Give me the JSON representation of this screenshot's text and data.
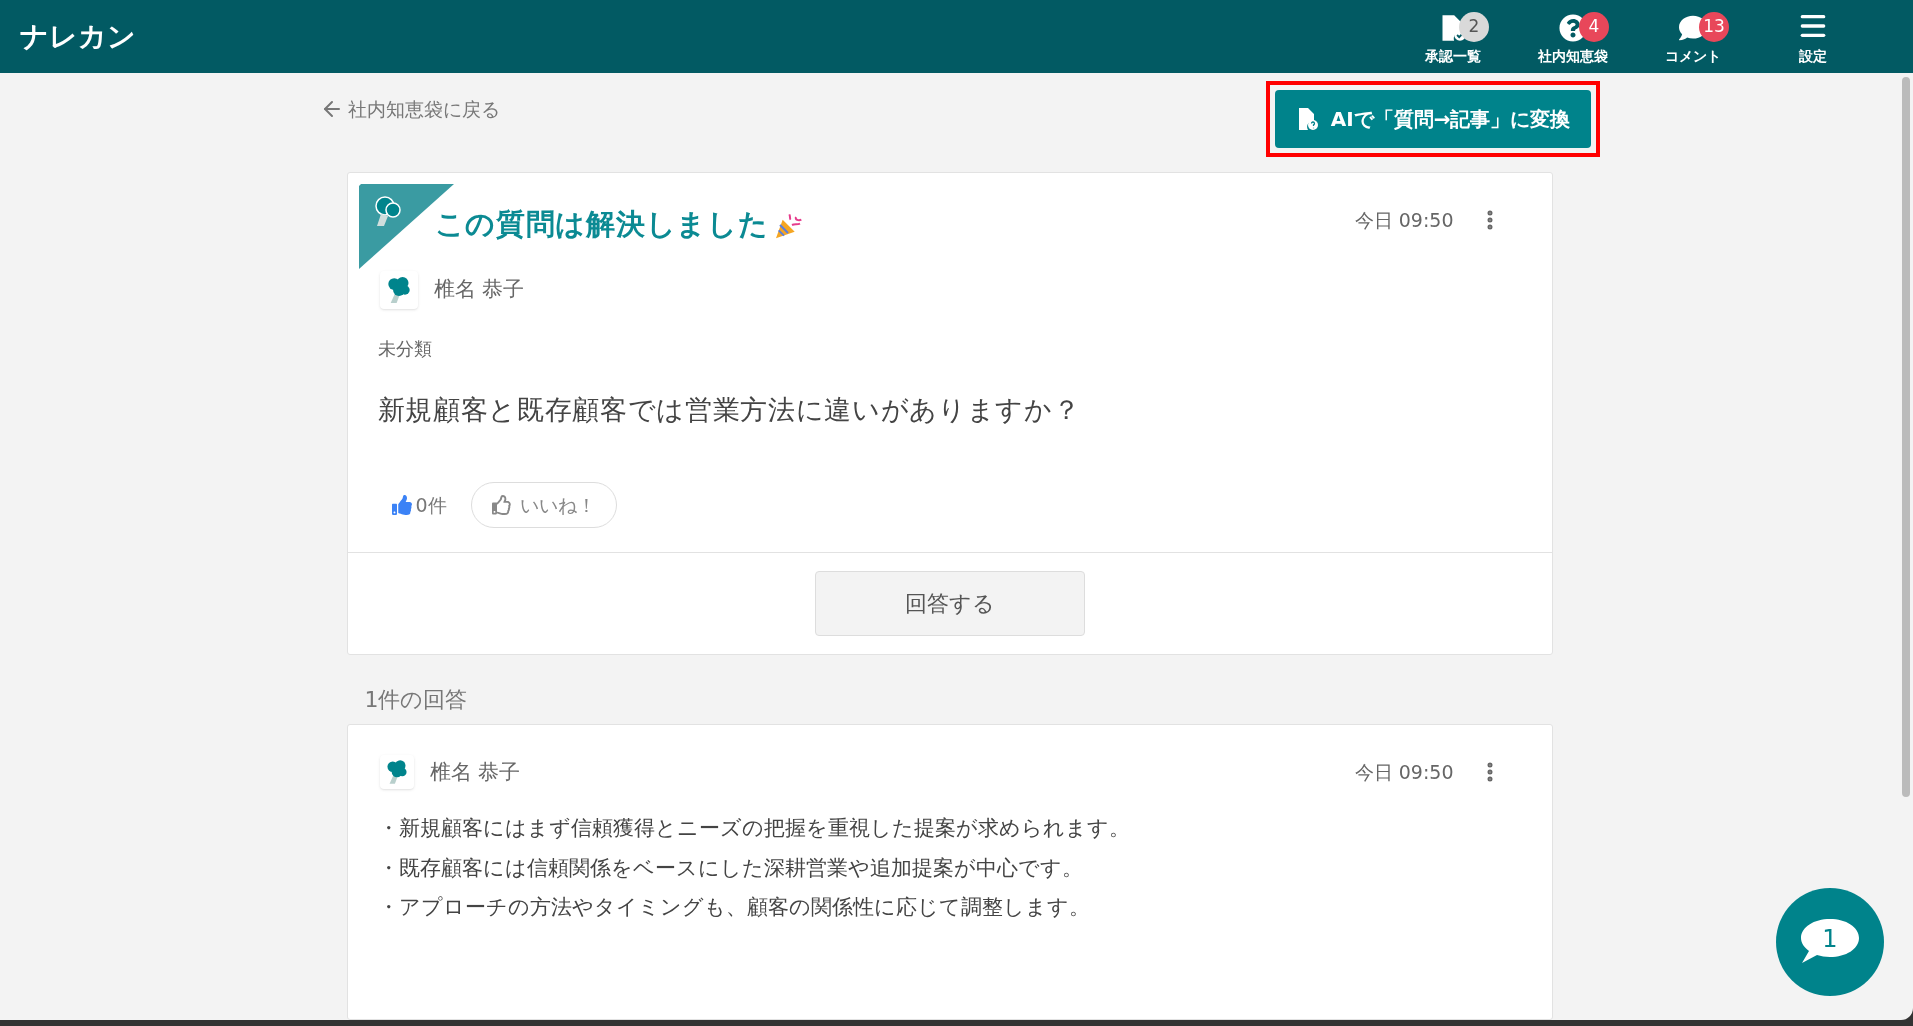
{
  "app": {
    "title": "ナレカン"
  },
  "nav": [
    {
      "kind": "approval",
      "label": "承認一覧",
      "badge": "2",
      "color": "#d9d9d9"
    },
    {
      "kind": "question",
      "label": "社内知恵袋",
      "badge": "4",
      "color": "#e8475a"
    },
    {
      "kind": "comment",
      "label": "コメント",
      "badge": "13",
      "color": "#e8475a"
    },
    {
      "kind": "menu",
      "label": "設定"
    }
  ],
  "back_link": "社内知恵袋に戻る",
  "convert_button": "AIで「質問→記事」に変換",
  "question": {
    "resolved_banner": "この質問は解決しました",
    "time": "今日 09:50",
    "author": "椎名 恭子",
    "category": "未分類",
    "body": "新規顧客と既存顧客では営業方法に違いがありますか？",
    "like_count": "0件",
    "like_button": "いいね！"
  },
  "answer_button": "回答する",
  "answers_heading": "1件の回答",
  "answers": [
    {
      "author": "椎名 恭子",
      "time": "今日 09:50",
      "lines": [
        "・新規顧客にはまず信頼獲得とニーズの把握を重視した提案が求められます。",
        "・既存顧客には信頼関係をベースにした深耕営業や追加提案が中心です。",
        "・アプローチの方法やタイミングも、顧客の関係性に応じて調整します。"
      ]
    }
  ],
  "chat_fab": {
    "count": "1"
  }
}
